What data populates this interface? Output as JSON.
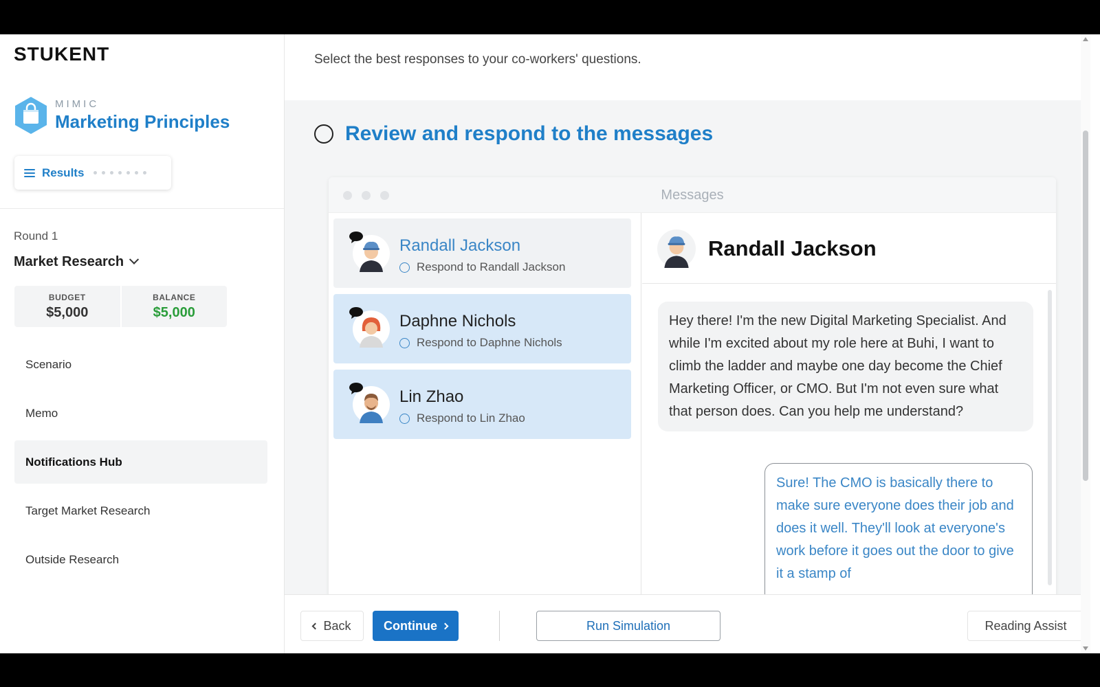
{
  "sidebar": {
    "logo_text": "STUKENT",
    "brand_sub": "MIMIC",
    "brand_title": "Marketing Principles",
    "results_label": "Results",
    "round_label": "Round 1",
    "phase_label": "Market Research",
    "budget_label": "BUDGET",
    "budget_value": "$5,000",
    "balance_label": "BALANCE",
    "balance_value": "$5,000",
    "nav": [
      {
        "label": "Scenario"
      },
      {
        "label": "Memo"
      },
      {
        "label": "Notifications Hub",
        "active": true
      },
      {
        "label": "Target Market Research"
      },
      {
        "label": "Outside Research"
      }
    ]
  },
  "main": {
    "instruction": "Select the best responses to your co-workers' questions.",
    "task_title": "Review and respond to the messages",
    "window_title": "Messages",
    "contacts": [
      {
        "name": "Randall Jackson",
        "status": "Respond to Randall Jackson",
        "active": true
      },
      {
        "name": "Daphne Nichols",
        "status": "Respond to Daphne Nichols"
      },
      {
        "name": "Lin Zhao",
        "status": "Respond to Lin Zhao"
      }
    ],
    "conversation": {
      "name": "Randall Jackson",
      "incoming": "Hey there! I'm the new Digital Marketing Specialist. And while I'm excited about my role here at Buhi, I want to climb the ladder and maybe one day become the Chief Marketing Officer, or CMO. But I'm not even sure what that person does. Can you help me understand?",
      "outgoing": "Sure! The CMO is basically there to make sure everyone does their job and does it well. They'll look at everyone's work before it goes out the door to give it a stamp of"
    }
  },
  "footer": {
    "back_label": "Back",
    "continue_label": "Continue",
    "run_label": "Run Simulation",
    "assist_label": "Reading Assist"
  },
  "colors": {
    "brand_blue": "#1f7fc8",
    "primary_button": "#1a73c6",
    "balance_green": "#2a9d3a",
    "contact_highlight": "#d7e8f8"
  }
}
